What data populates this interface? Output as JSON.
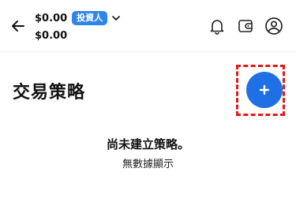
{
  "header": {
    "balance_primary": "$0.00",
    "balance_secondary": "$0.00",
    "role_badge": "投資人",
    "icons": [
      "arrow-left-icon",
      "chevron-down-icon",
      "bell-icon",
      "wallet-icon",
      "user-circle-icon"
    ]
  },
  "page": {
    "title": "交易策略",
    "add_button": {
      "label": "+",
      "icon": "plus-icon",
      "color": "#1f6fe5",
      "highlight_color": "#e01818"
    }
  },
  "empty_state": {
    "title": "尚未建立策略。",
    "subtitle": "無數據顯示"
  },
  "colors": {
    "accent": "#1f6fe5",
    "badge": "#2f86e8"
  }
}
